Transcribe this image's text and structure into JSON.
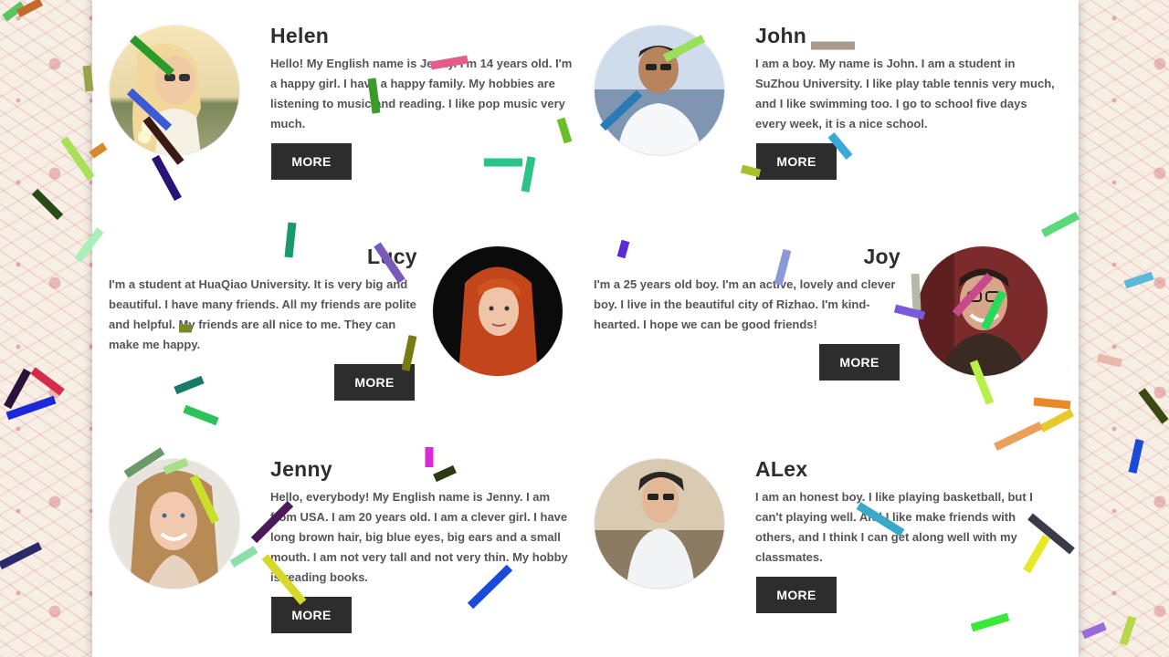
{
  "profiles": [
    {
      "name": "Helen",
      "bio": "Hello! My English name is Jenny. I'm 14 years old. I'm a happy girl. I have a happy family. My hobbies are listening to music and reading. I like pop music very much.",
      "button": "MORE",
      "avatar": "woman-with-sunglasses-portrait"
    },
    {
      "name": "John",
      "bio": "I am a boy. My name is John. I am a student in SuZhou University. I like play table tennis very much, and I like swimming too. I go to school five days every week, it is a nice school.",
      "button": "MORE",
      "avatar": "man-with-sunglasses-portrait"
    },
    {
      "name": "Lucy",
      "bio": "I'm a student at HuaQiao University. It is very big and beautiful. I have many friends. All my friends are polite and helpful. My friends are all nice to me. They can make me happy.",
      "button": "MORE",
      "avatar": "red-haired-woman-portrait"
    },
    {
      "name": "Joy",
      "bio": "I'm a 25 years old boy. I'm an active, lovely and clever boy. I live in the beautiful city of Rizhao. I'm kind-hearted. I hope we can be good friends!",
      "button": "MORE",
      "avatar": "smiling-man-with-glasses-portrait"
    },
    {
      "name": "Jenny",
      "bio": "Hello, everybody! My English name is Jenny. I am from USA. I am 20 years old. I am a clever girl. I have long brown hair, big blue eyes, big ears and a small mouth. I am not very tall and not very thin. My hobby is reading books.",
      "button": "MORE",
      "avatar": "blonde-woman-smiling-portrait"
    },
    {
      "name": "ALex",
      "bio": "I am an honest boy. I like playing basketball, but I can't playing well. And I like make friends with others, and I think I can get along well with my classmates.",
      "button": "MORE",
      "avatar": "young-man-with-sunglasses-portrait"
    }
  ]
}
